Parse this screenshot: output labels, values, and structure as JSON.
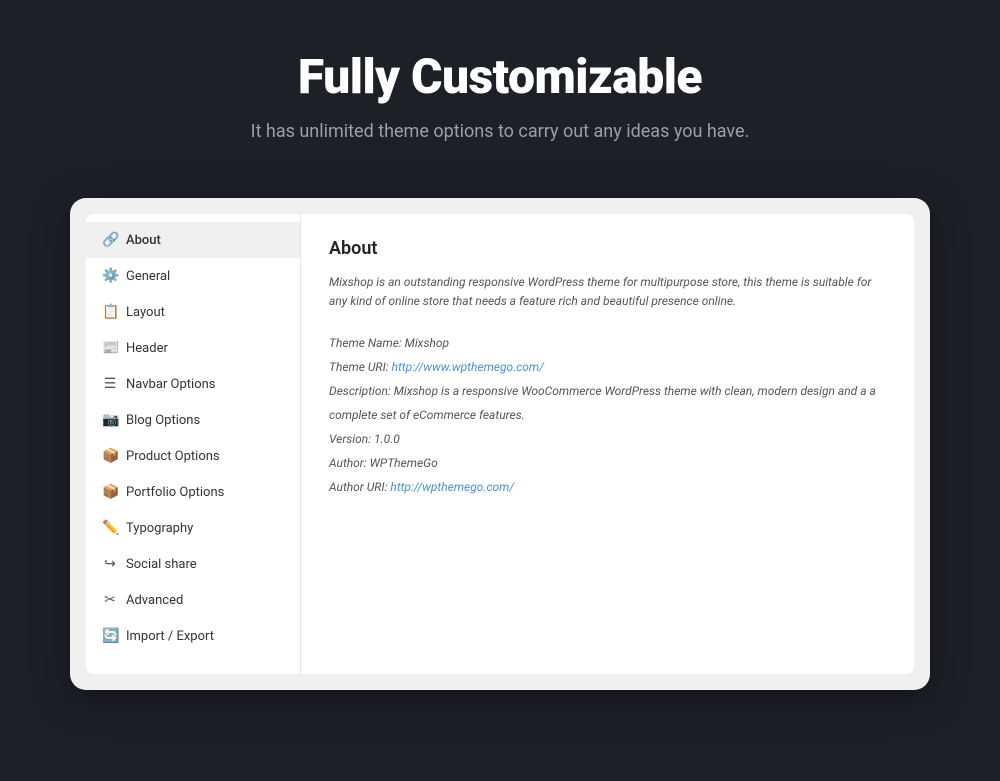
{
  "header": {
    "title": "Fully Customizable",
    "subtitle": "It has unlimited theme options to carry out any ideas you have."
  },
  "sidebar": {
    "items": [
      {
        "id": "about",
        "label": "About",
        "icon": "🔗",
        "active": true
      },
      {
        "id": "general",
        "label": "General",
        "icon": "⚙️",
        "active": false
      },
      {
        "id": "layout",
        "label": "Layout",
        "icon": "📋",
        "active": false
      },
      {
        "id": "header",
        "label": "Header",
        "icon": "📰",
        "active": false
      },
      {
        "id": "navbar",
        "label": "Navbar Options",
        "icon": "☰",
        "active": false
      },
      {
        "id": "blog",
        "label": "Blog Options",
        "icon": "📷",
        "active": false
      },
      {
        "id": "product",
        "label": "Product Options",
        "icon": "📦",
        "active": false
      },
      {
        "id": "portfolio",
        "label": "Portfolio Options",
        "icon": "📦",
        "active": false
      },
      {
        "id": "typography",
        "label": "Typography",
        "icon": "✏️",
        "active": false
      },
      {
        "id": "social",
        "label": "Social share",
        "icon": "↪",
        "active": false
      },
      {
        "id": "advanced",
        "label": "Advanced",
        "icon": "✂",
        "active": false
      },
      {
        "id": "import",
        "label": "Import / Export",
        "icon": "🔄",
        "active": false
      }
    ]
  },
  "content": {
    "title": "About",
    "description": "Mixshop is an outstanding responsive WordPress theme for multipurpose store, this theme is suitable for any kind of online store that needs a feature rich and beautiful presence online.",
    "theme_name_label": "Theme Name: Mixshop",
    "theme_uri_label": "Theme URI: ",
    "theme_uri_link": "http://www.wpthemego.com/",
    "description_label": "Description: Mixshop is a responsive WooCommerce WordPress theme with clean, modern design and a a complete set of eCommerce features.",
    "version_label": "Version: 1.0.0",
    "author_label": "Author: WPThemeGo",
    "author_uri_label": "Author URI: ",
    "author_uri_link": "http://wpthemego.com/"
  }
}
